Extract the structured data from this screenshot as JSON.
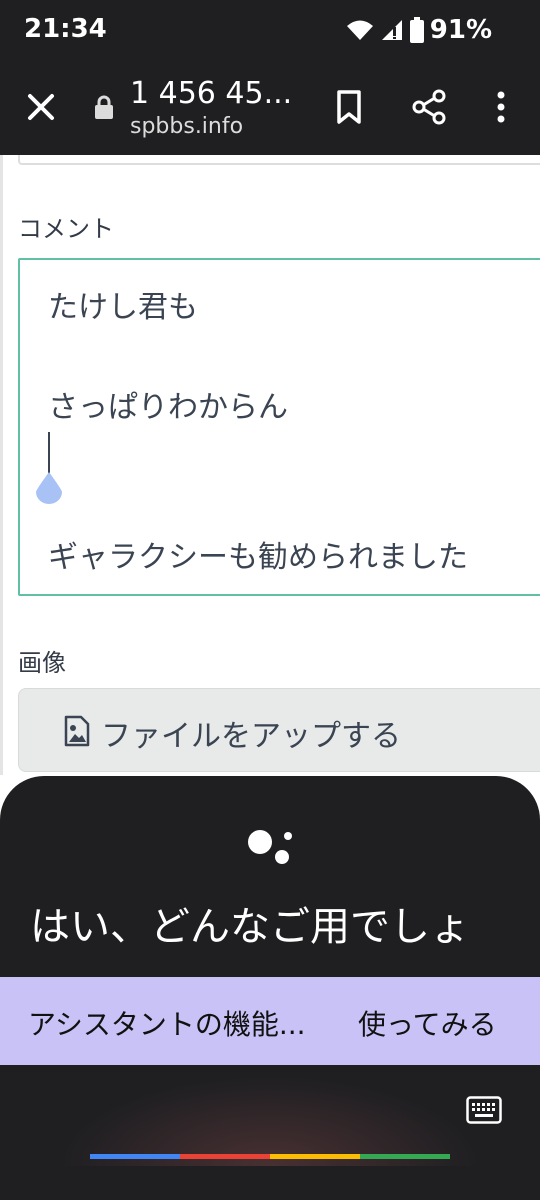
{
  "status_bar": {
    "time": "21:34",
    "battery": "91%",
    "icons": [
      "wifi-icon",
      "signal-icon",
      "battery-icon"
    ]
  },
  "browser": {
    "title": "1 456 45...",
    "domain": "spbbs.info",
    "icons": [
      "close-icon",
      "lock-icon",
      "bookmark-icon",
      "share-icon",
      "more-vert-icon"
    ]
  },
  "form": {
    "comment_label": "コメント",
    "comment_lines": [
      "たけし君も",
      "さっぱりわからん",
      "ギャラクシーも勧められました"
    ],
    "image_label": "画像",
    "upload_label": "ファイルをアップする",
    "upload_icon": "image-icon"
  },
  "assistant": {
    "greeting": "はい、どんなご用でしょ",
    "suggestions": [
      "アシスタントの機能...",
      "使ってみる"
    ],
    "icons": [
      "assistant-logo-icon",
      "keyboard-icon"
    ],
    "colors": {
      "accent_blue": "#4285f4",
      "accent_red": "#ea4335",
      "accent_yellow": "#fbbc04",
      "accent_green": "#34a853",
      "suggestion_bg": "#c8c2f7",
      "comment_border": "#5fc0a6"
    }
  }
}
